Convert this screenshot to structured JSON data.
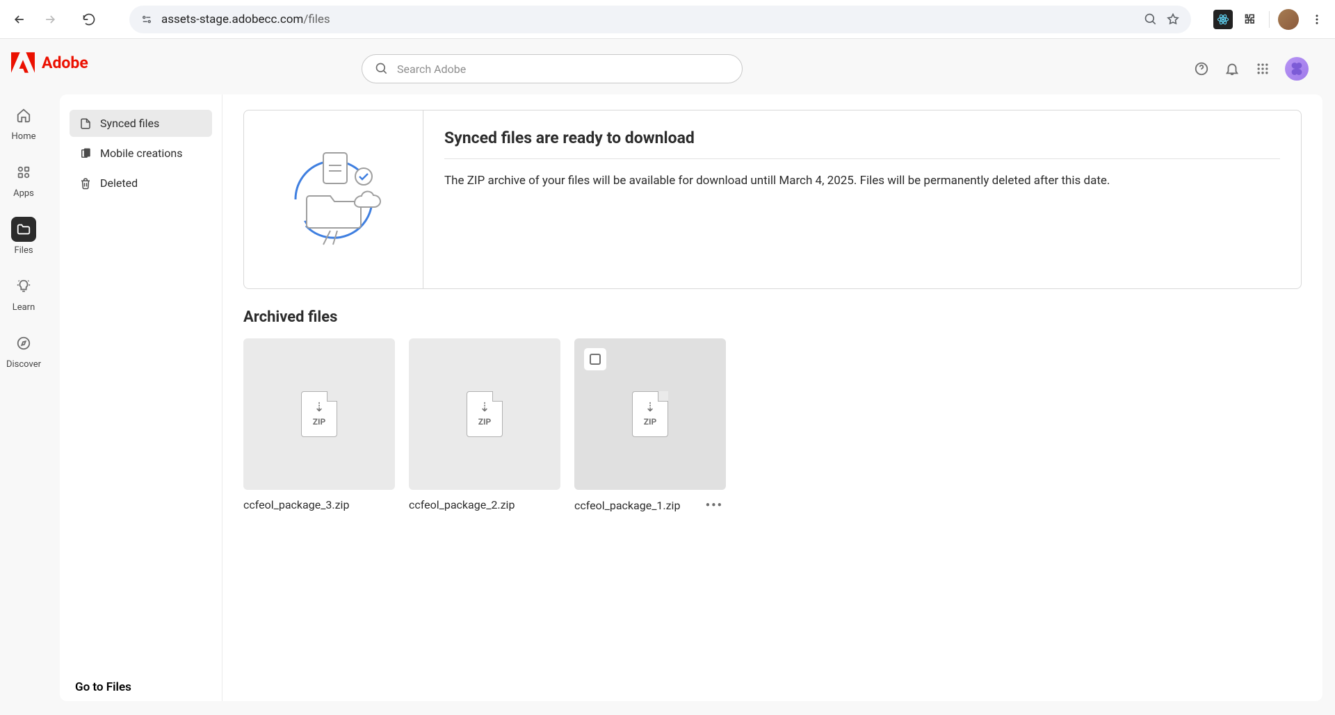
{
  "browser": {
    "url_host": "assets-stage.adobecc.com",
    "url_path": "/files"
  },
  "brand": {
    "name": "Adobe"
  },
  "search": {
    "placeholder": "Search Adobe"
  },
  "rail": {
    "items": [
      {
        "label": "Home"
      },
      {
        "label": "Apps"
      },
      {
        "label": "Files"
      },
      {
        "label": "Learn"
      },
      {
        "label": "Discover"
      }
    ]
  },
  "sidebar": {
    "items": [
      {
        "label": "Synced files"
      },
      {
        "label": "Mobile creations"
      },
      {
        "label": "Deleted"
      }
    ],
    "go_to_files": "Go to Files"
  },
  "banner": {
    "title": "Synced files are ready to download",
    "text": "The ZIP archive of your files will be available for download untill March 4, 2025. Files will be permanently deleted after this date."
  },
  "archived": {
    "title": "Archived files",
    "files": [
      {
        "name": "ccfeol_package_3.zip",
        "type": "ZIP"
      },
      {
        "name": "ccfeol_package_2.zip",
        "type": "ZIP"
      },
      {
        "name": "ccfeol_package_1.zip",
        "type": "ZIP"
      }
    ]
  }
}
